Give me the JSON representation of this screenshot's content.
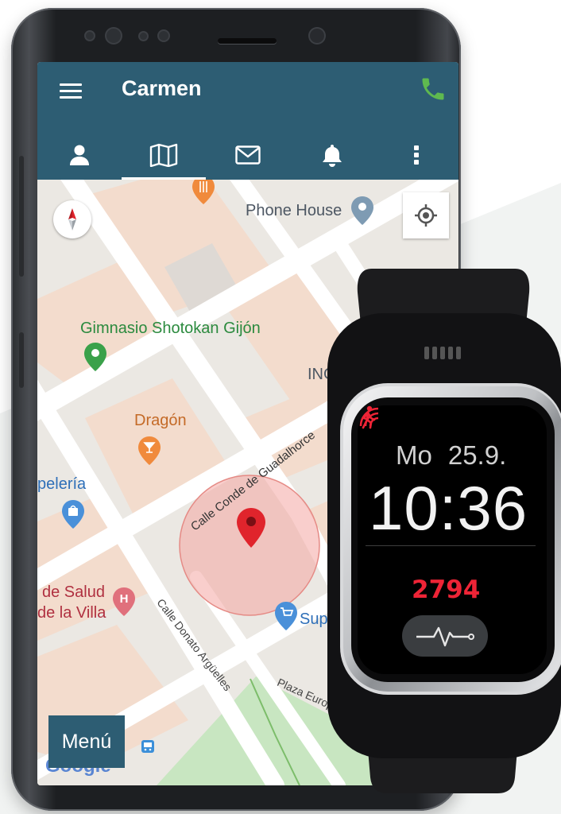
{
  "colors": {
    "app_bar": "#2d5d73",
    "call_green": "#5fb94f",
    "accent_red": "#ee2436",
    "map_base": "#e9e7e2",
    "park_green": "#c8e6c1"
  },
  "app": {
    "title": "Carmen",
    "menu_icon": "hamburger-menu-icon",
    "call_icon": "phone-call-icon",
    "tabs": [
      {
        "icon": "person-icon",
        "active": false
      },
      {
        "icon": "map-icon",
        "active": true
      },
      {
        "icon": "envelope-icon",
        "active": false
      },
      {
        "icon": "bell-icon",
        "active": false
      },
      {
        "icon": "more-vertical-icon",
        "active": false
      }
    ]
  },
  "map": {
    "places": {
      "phone_house": "Phone House",
      "gym": "Gimnasio Shotokan Gijón",
      "ing": "ING",
      "dragon": "Dragón",
      "papeleria": "pelería",
      "salud_1": "de Salud",
      "salud_2": "de la Villa",
      "super": "Supe"
    },
    "streets": {
      "guadalhorce": "Calle Conde de Guadalhorce",
      "donato": "Calle Donato Argüelles",
      "plaza_europa": "Plaza Europa"
    },
    "menu_button": "Menú",
    "attribution": "Google"
  },
  "watch": {
    "day": "Mo",
    "date": "25.9.",
    "time": "10:36",
    "steps": "2794",
    "heart_rate_icon": "heartbeat-icon"
  }
}
